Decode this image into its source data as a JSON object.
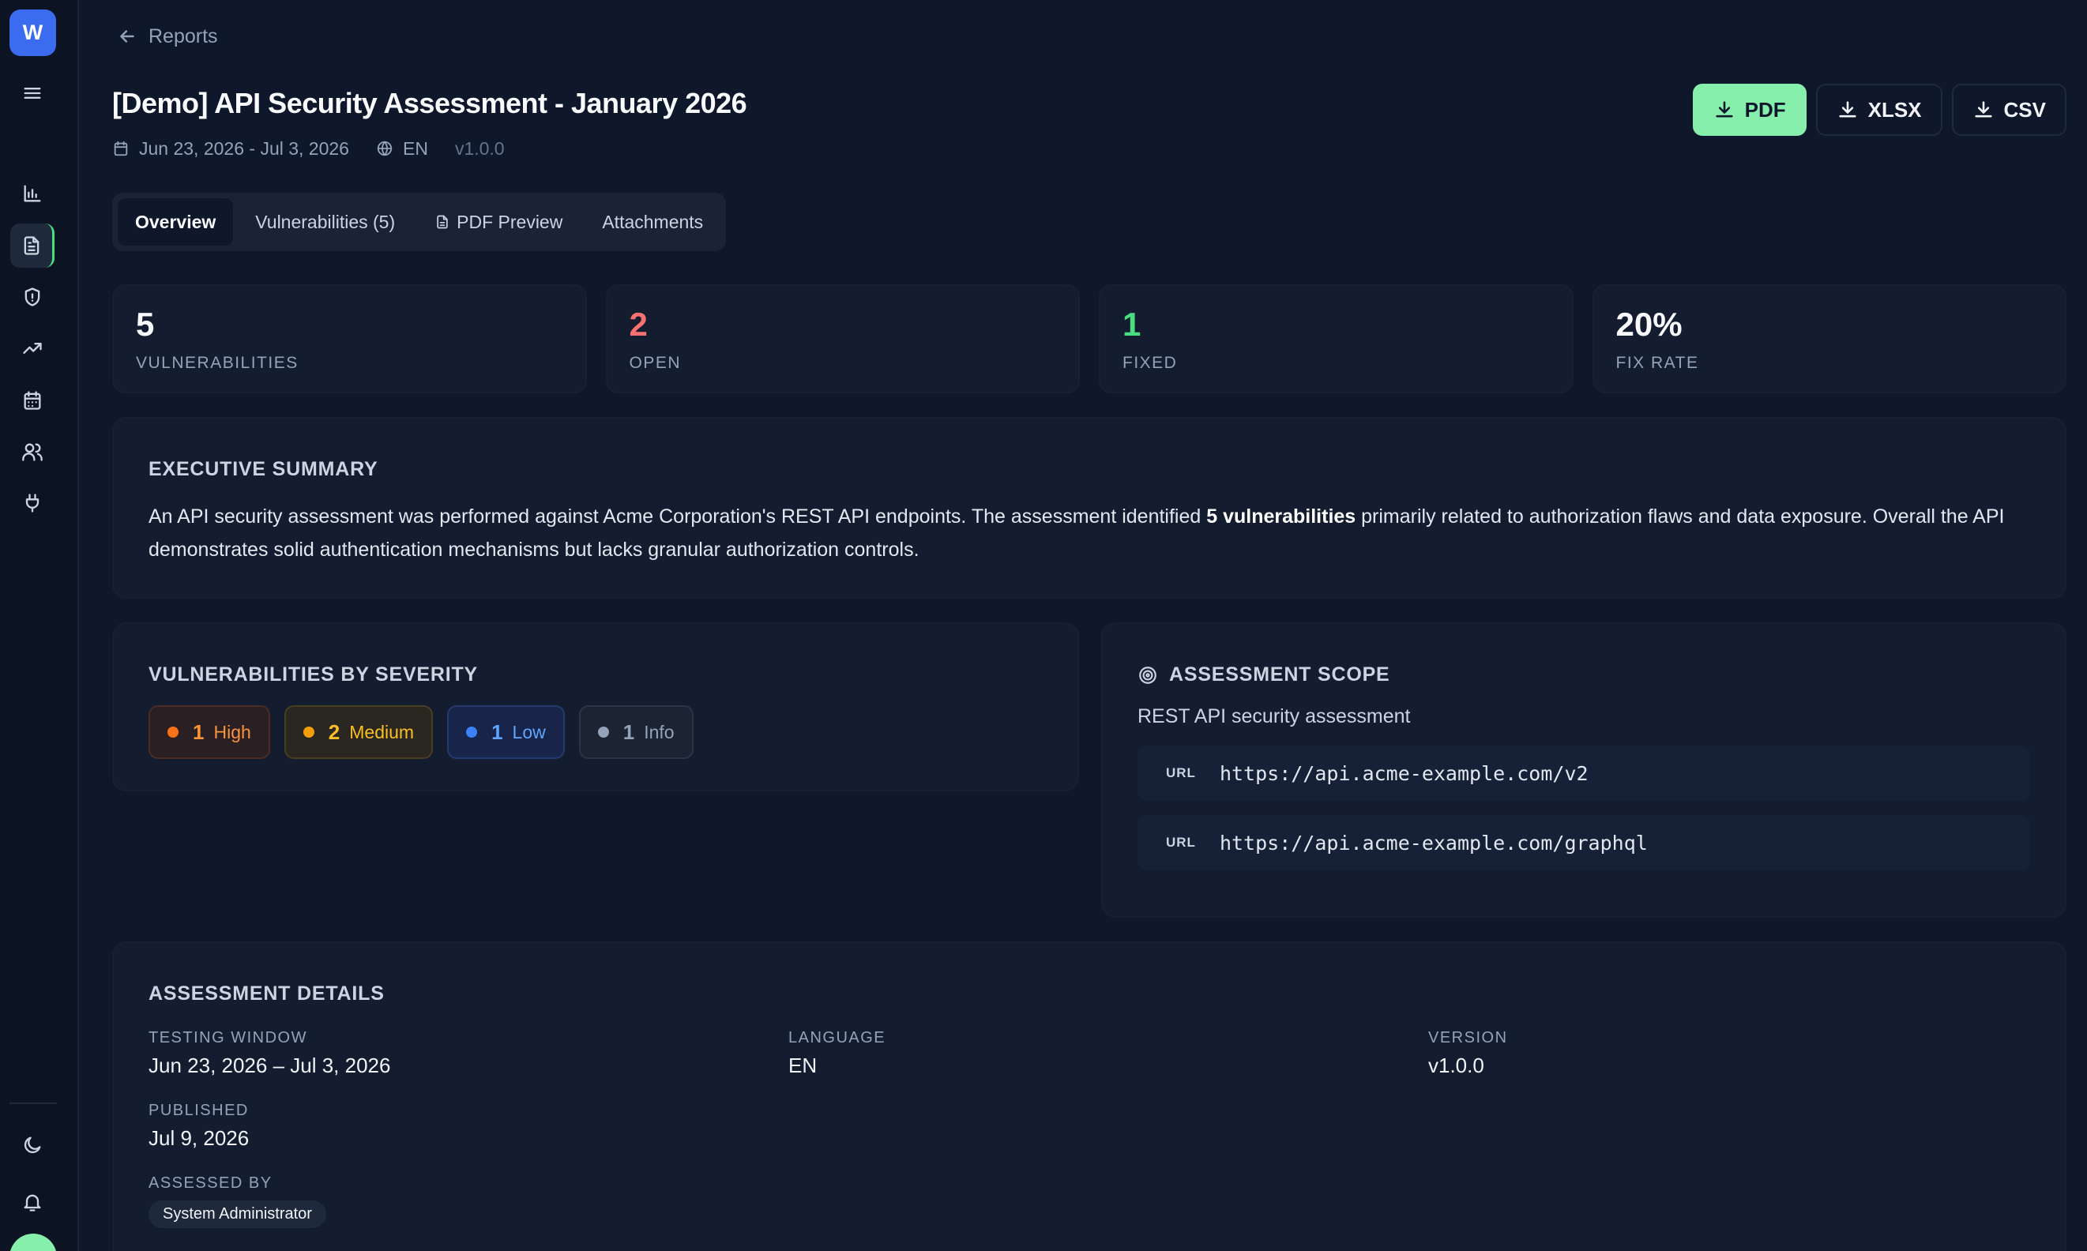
{
  "sidebar": {
    "logo_letter": "W",
    "items": [
      {
        "name": "menu-icon"
      },
      {
        "name": "bar-chart-icon"
      },
      {
        "name": "file-text-icon",
        "active": true
      },
      {
        "name": "shield-icon"
      },
      {
        "name": "trending-up-icon"
      },
      {
        "name": "calendar-icon"
      },
      {
        "name": "users-icon"
      },
      {
        "name": "plug-icon"
      },
      {
        "name": "moon-icon"
      },
      {
        "name": "bell-icon"
      }
    ]
  },
  "breadcrumb": {
    "back_label": "Reports"
  },
  "report": {
    "title": "[Demo] API Security Assessment - January 2026",
    "date_range": "Jun 23, 2026 - Jul 3, 2026",
    "language": "EN",
    "version": "v1.0.0"
  },
  "exports": {
    "pdf": "PDF",
    "xlsx": "XLSX",
    "csv": "CSV"
  },
  "tabs": {
    "overview": "Overview",
    "vulnerabilities": "Vulnerabilities (5)",
    "pdf_preview": "PDF Preview",
    "attachments": "Attachments"
  },
  "stats": [
    {
      "value": "5",
      "label": "VULNERABILITIES"
    },
    {
      "value": "2",
      "label": "OPEN"
    },
    {
      "value": "1",
      "label": "FIXED"
    },
    {
      "value": "20%",
      "label": "FIX RATE"
    }
  ],
  "executive_summary": {
    "heading": "EXECUTIVE SUMMARY",
    "text_before": "An API security assessment was performed against Acme Corporation's REST API endpoints. The assessment identified ",
    "text_bold": "5 vulnerabilities",
    "text_after": " primarily related to authorization flaws and data exposure. Overall the API demonstrates solid authentication mechanisms but lacks granular authorization controls."
  },
  "severity": {
    "heading": "VULNERABILITIES BY SEVERITY",
    "items": [
      {
        "count": "1",
        "label": "High"
      },
      {
        "count": "2",
        "label": "Medium"
      },
      {
        "count": "1",
        "label": "Low"
      },
      {
        "count": "1",
        "label": "Info"
      }
    ]
  },
  "scope": {
    "heading": "ASSESSMENT SCOPE",
    "description": "REST API security assessment",
    "targets": [
      {
        "tag": "URL",
        "url": "https://api.acme-example.com/v2"
      },
      {
        "tag": "URL",
        "url": "https://api.acme-example.com/graphql"
      }
    ]
  },
  "details": {
    "heading": "ASSESSMENT DETAILS",
    "testing_window_label": "TESTING WINDOW",
    "testing_window": "Jun 23, 2026 – Jul 3, 2026",
    "language_label": "LANGUAGE",
    "language": "EN",
    "version_label": "VERSION",
    "version": "v1.0.0",
    "published_label": "PUBLISHED",
    "published": "Jul 9, 2026",
    "assessed_by_label": "ASSESSED BY",
    "assessed_by": "System Administrator"
  },
  "colors": {
    "background": "#0f172a",
    "accent_green": "#86efac",
    "brand_blue": "#3b6cf0",
    "open_red": "#f87171",
    "fixed_green": "#4ade80"
  }
}
